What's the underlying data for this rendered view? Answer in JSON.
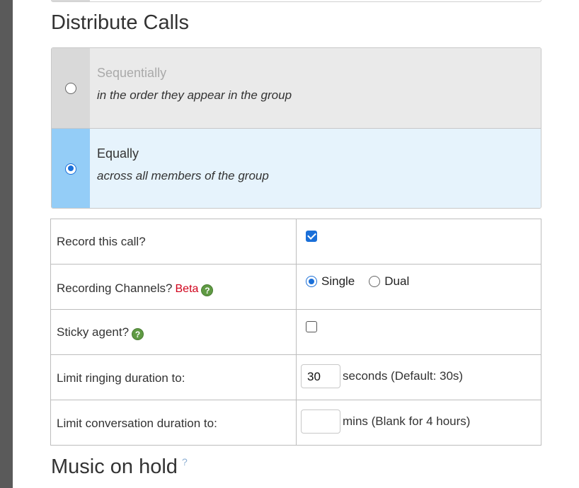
{
  "sections": {
    "distribute_title": "Distribute Calls",
    "music_title": "Music on hold",
    "music_help": "?"
  },
  "distribute_options": [
    {
      "title": "Sequentially",
      "subtitle": "in the order they appear in the group",
      "selected": false
    },
    {
      "title": "Equally",
      "subtitle": "across all members of the group",
      "selected": true
    }
  ],
  "settings": {
    "record": {
      "label": "Record this call?",
      "checked": true
    },
    "channels": {
      "label": "Recording Channels?",
      "beta": "Beta",
      "options": [
        "Single",
        "Dual"
      ],
      "selected": "Single"
    },
    "sticky": {
      "label": "Sticky agent?",
      "checked": false
    },
    "ring_limit": {
      "label": "Limit ringing duration to:",
      "value": "30",
      "suffix": "seconds (Default: 30s)"
    },
    "conv_limit": {
      "label": "Limit conversation duration to:",
      "value": "",
      "suffix": "mins (Blank for 4 hours)"
    }
  },
  "colors": {
    "selected_accent": "#94cdf7",
    "selected_bg": "#e6f3fc",
    "beta_red": "#d0021b",
    "help_green": "#5f9a43",
    "control_blue": "#1a6fd8"
  },
  "icons": {
    "help": "question-mark-icon"
  }
}
